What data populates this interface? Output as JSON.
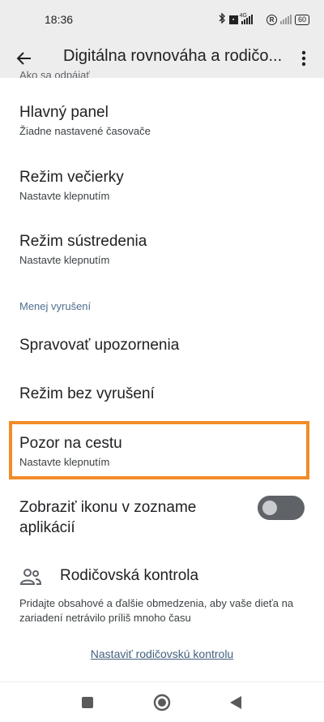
{
  "status_bar": {
    "time": "18:36",
    "network": "4G",
    "battery": "60"
  },
  "app_bar": {
    "title": "Digitálna rovnováha a rodičo..."
  },
  "partial_header": "Ako sa odpájať",
  "items": [
    {
      "title": "Hlavný panel",
      "subtitle": "Žiadne nastavené časovače"
    },
    {
      "title": "Režim večierky",
      "subtitle": "Nastavte klepnutím"
    },
    {
      "title": "Režim sústredenia",
      "subtitle": "Nastavte klepnutím"
    }
  ],
  "section_less_interruptions": "Menej vyrušení",
  "items2": [
    {
      "title": "Spravovať upozornenia"
    },
    {
      "title": "Režim bez vyrušení"
    },
    {
      "title": "Pozor na cestu",
      "subtitle": "Nastavte klepnutím"
    }
  ],
  "toggle_item": {
    "line1": "Zobraziť ikonu v zozname",
    "line2": "aplikácií",
    "enabled": false
  },
  "parental": {
    "title": "Rodičovská kontrola",
    "description": "Pridajte obsahové a ďalšie obmedzenia, aby vaše dieťa na zariadení netrávilo príliš mnoho času",
    "link": "Nastaviť rodičovskú kontrolu"
  },
  "colors": {
    "highlight": "#f28c28",
    "section_header": "#4f6e8f",
    "link": "#42607f"
  }
}
